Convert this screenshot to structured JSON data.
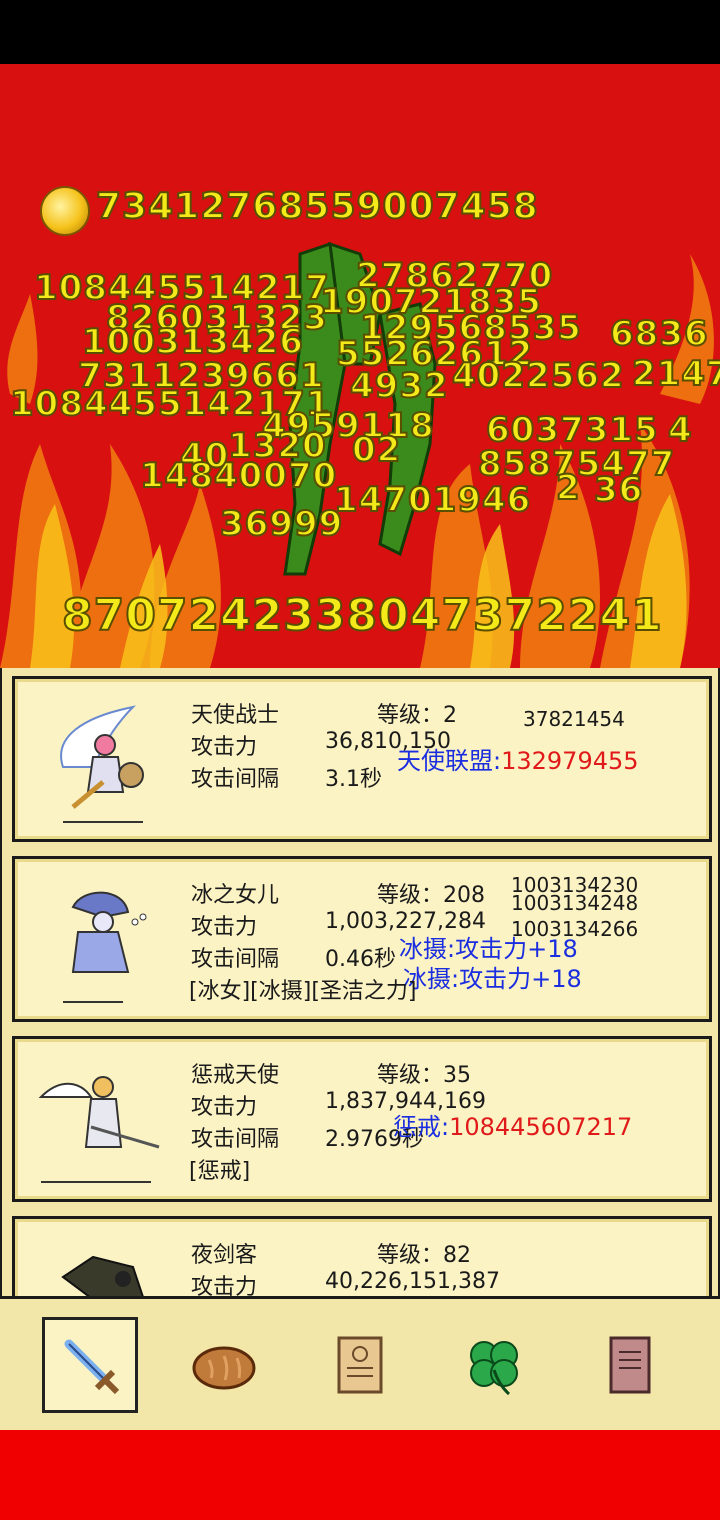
{
  "gold": "73412768559007458",
  "damage_numbers": [
    "108445514217",
    "27862770",
    "190721835",
    "826031323",
    "100313426",
    "129568535",
    "6836",
    "55262612",
    "7311239661",
    "4932",
    "4022562",
    "2147",
    "1084455142171",
    "4959118",
    "6037315",
    "4",
    "1320",
    "02",
    "40",
    "85875477",
    "14840070",
    "2",
    "14701946",
    "36",
    "36999"
  ],
  "boss_hp": "8707242338047372241",
  "heroes": [
    {
      "name": "天使战士",
      "level_label": "等级：2",
      "atk_label": "攻击力",
      "atk_value": "36,810,150",
      "interval_label": "攻击间隔",
      "interval_value": "3.1秒",
      "float_top": "37821454",
      "float_skill_label": "天使联盟:",
      "float_skill_value": "132979455"
    },
    {
      "name": "冰之女儿",
      "level_label": "等级：208",
      "atk_label": "攻击力",
      "atk_value": "1,003,227,284",
      "interval_label": "攻击间隔",
      "interval_value": "0.46秒",
      "tags": "[冰女][冰摄][圣洁之力]",
      "float_top1": "1003134230",
      "float_top2": "1003134248",
      "float_top3": "1003134266",
      "float_skill1": "冰摄:攻击力+18",
      "float_skill2": "冰摄:攻击力+18"
    },
    {
      "name": "惩戒天使",
      "level_label": "等级：35",
      "atk_label": "攻击力",
      "atk_value": "1,837,944,169",
      "interval_label": "攻击间隔",
      "interval_value": "2.9769秒",
      "tags": "[惩戒]",
      "float_skill_label": "惩戒:",
      "float_skill_value": "108445607217"
    },
    {
      "name": "夜剑客",
      "level_label": "等级：82",
      "atk_label": "攻击力",
      "atk_value": "40,226,151,387"
    }
  ],
  "tabs": [
    "sword-icon",
    "bread-icon",
    "scroll-icon",
    "clover-icon",
    "book-icon"
  ],
  "colors": {
    "bg_red": "#d81010",
    "panel": "#f2e7a8",
    "number_yellow": "#f4ea1a",
    "skill_blue": "#1a2ee0",
    "skill_red": "#e01a1a"
  }
}
